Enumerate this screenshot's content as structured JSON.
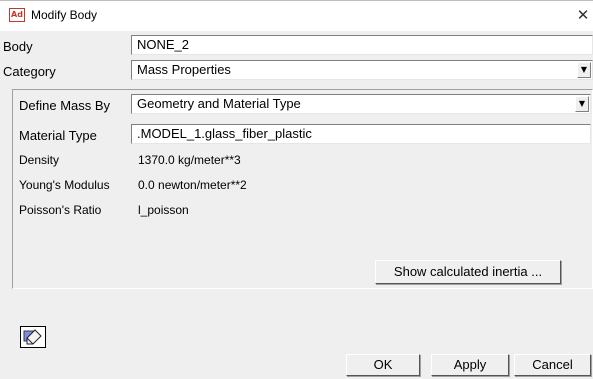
{
  "window": {
    "app_badge": "Ad",
    "title": "Modify Body",
    "close_glyph": "✕"
  },
  "form": {
    "body": {
      "label": "Body",
      "value": "NONE_2"
    },
    "category": {
      "label": "Category",
      "value": "Mass Properties"
    },
    "define_mass_by": {
      "label": "Define Mass By",
      "value": "Geometry and Material Type"
    },
    "material_type": {
      "label": "Material Type",
      "value": ".MODEL_1.glass_fiber_plastic"
    },
    "density": {
      "label": "Density",
      "value": "1370.0 kg/meter**3"
    },
    "youngs_modulus": {
      "label": "Young's Modulus",
      "value": "0.0 newton/meter**2"
    },
    "poissons_ratio": {
      "label": "Poisson's Ratio",
      "value": "l_poisson"
    },
    "show_inertia_label": "Show calculated inertia ..."
  },
  "footer": {
    "ok_label": "OK",
    "apply_label": "Apply",
    "cancel_label": "Cancel"
  },
  "icons": {
    "app": "adams-app-icon",
    "close": "close-icon",
    "dropdown": "chevron-down-icon",
    "edit": "edit-pencil-icon"
  },
  "colors": {
    "dialog_bg": "#efefef",
    "field_bg": "#ffffff",
    "app_badge": "#c0392b"
  }
}
